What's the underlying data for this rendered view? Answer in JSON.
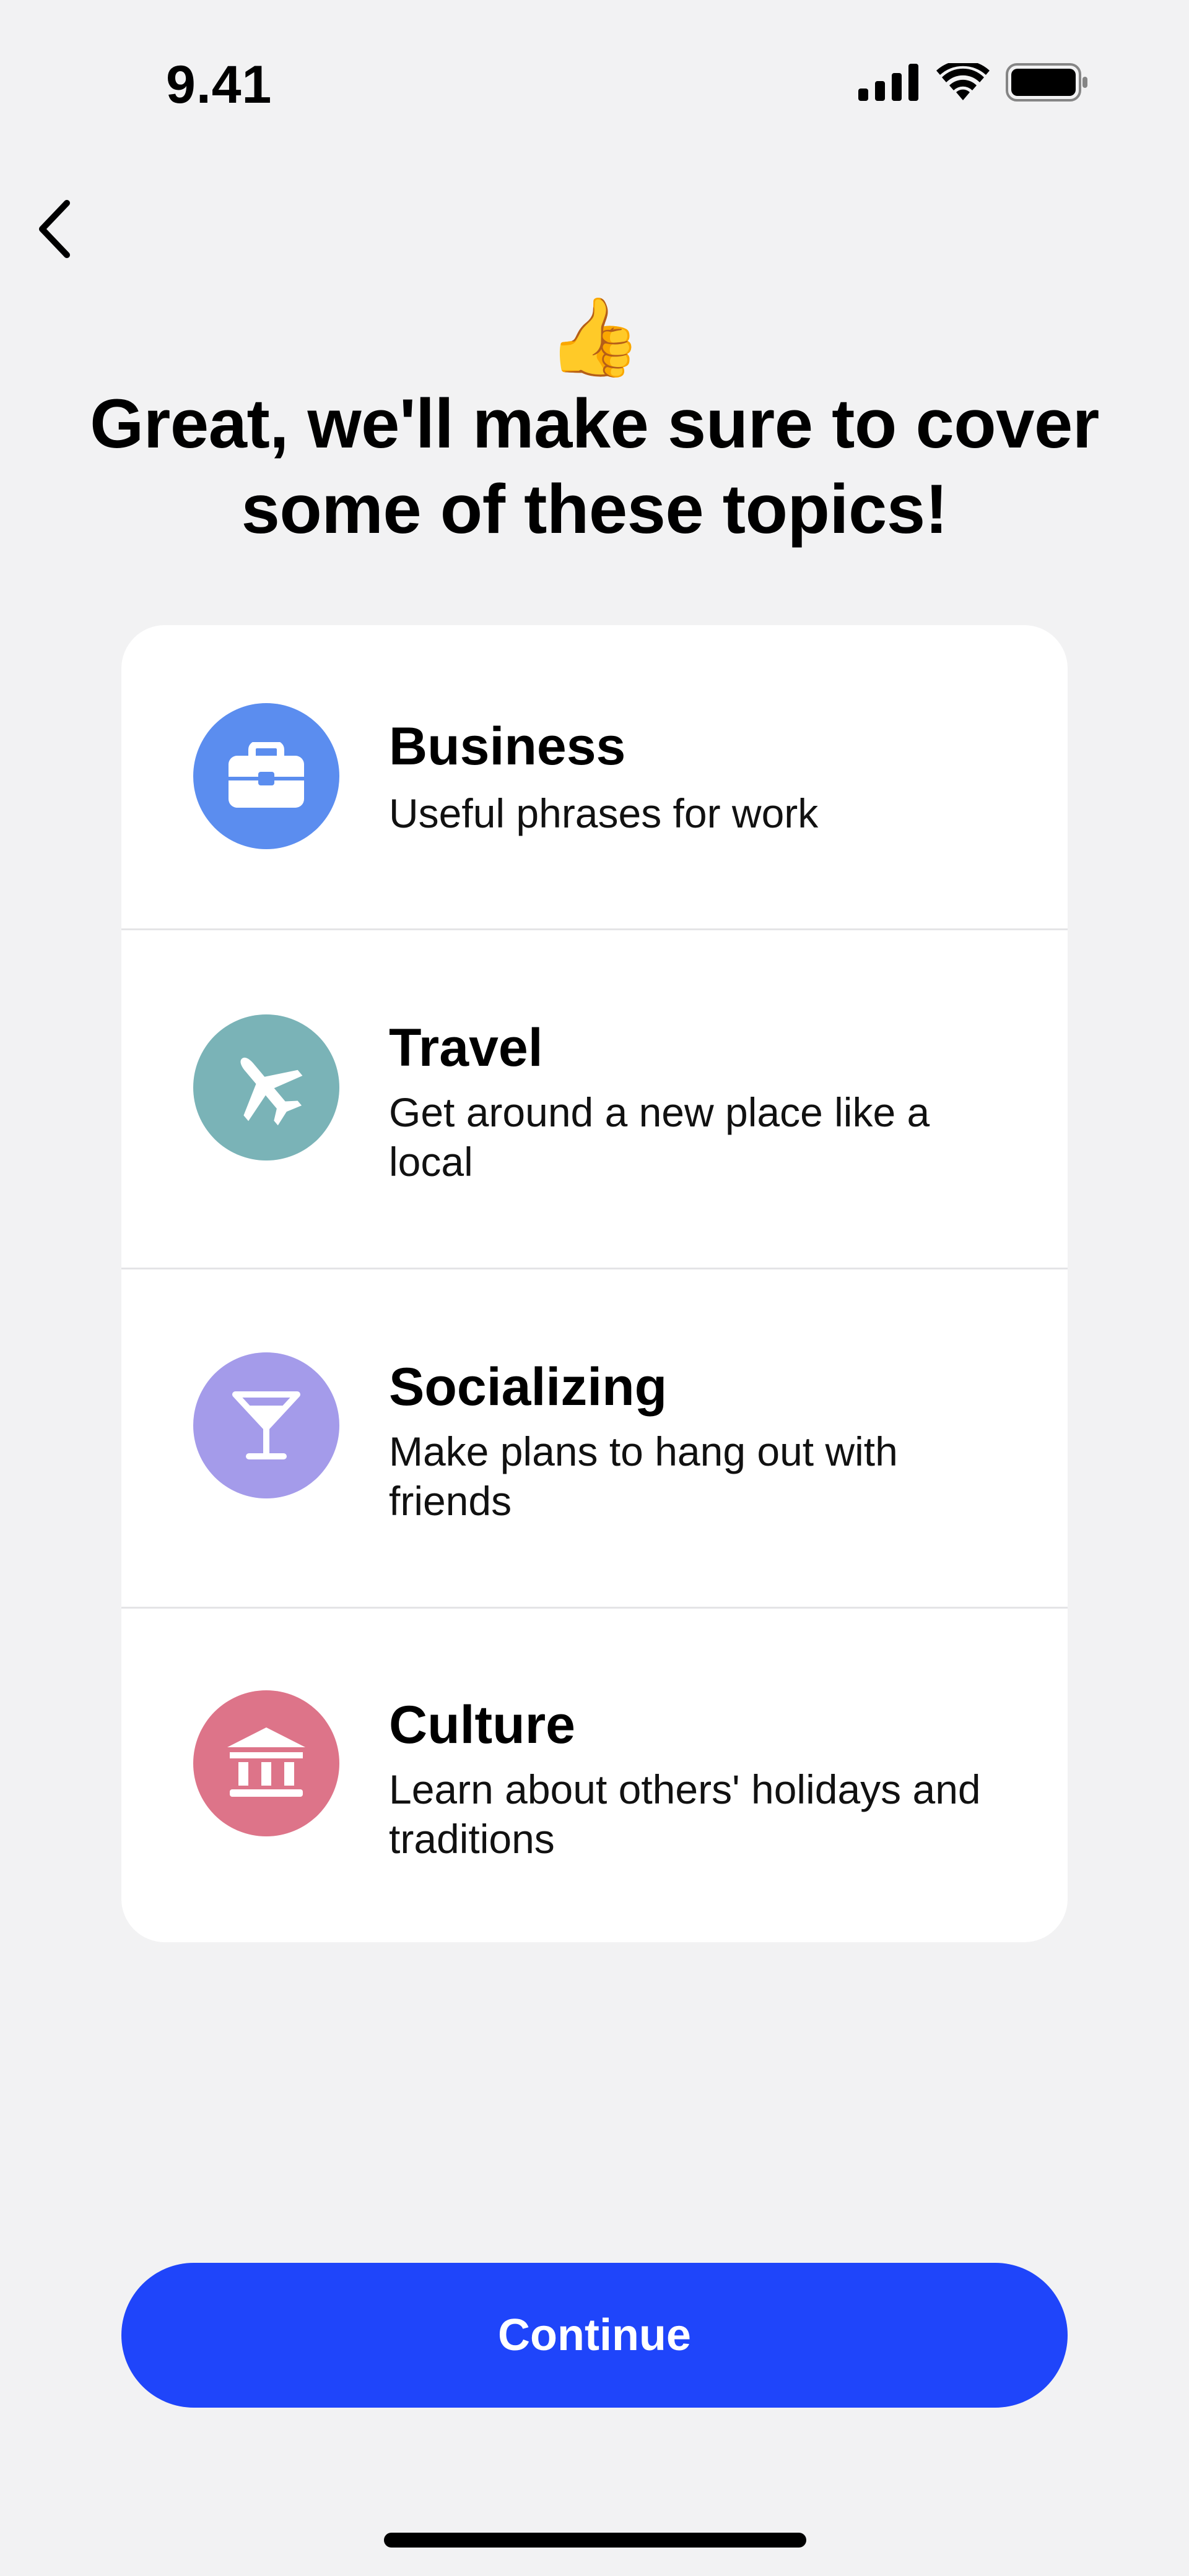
{
  "status_bar": {
    "time": "9.41"
  },
  "header": {
    "emoji": "👍",
    "headline": "Great, we'll make sure to cover some of these topics!"
  },
  "topics": [
    {
      "title": "Business",
      "description": "Useful phrases for work",
      "icon": "briefcase-icon",
      "color": "#5b8def"
    },
    {
      "title": "Travel",
      "description": "Get around a new place like a local",
      "icon": "airplane-icon",
      "color": "#7ab3b7"
    },
    {
      "title": "Socializing",
      "description": "Make plans to hang out with friends",
      "icon": "cocktail-icon",
      "color": "#a49bea"
    },
    {
      "title": "Culture",
      "description": "Learn about others' holidays and traditions",
      "icon": "museum-icon",
      "color": "#dd7489"
    }
  ],
  "footer": {
    "continue_label": "Continue",
    "accent": "#1f45fa"
  }
}
